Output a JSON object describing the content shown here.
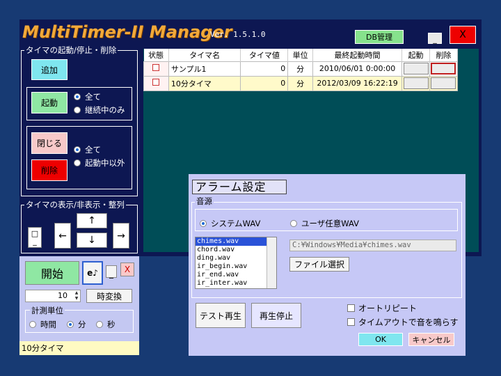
{
  "manager": {
    "title": "MultiTimer-II Manager",
    "version": "Ver. 1.5.1.0",
    "db_button": "DB管理",
    "minimize": "_",
    "close": "X",
    "control_group": {
      "legend": "タイマの起動/停止・削除",
      "add": "追加",
      "start": "起動",
      "start_opts": [
        "全て",
        "継続中のみ"
      ],
      "close": "閉じる",
      "delete": "削除",
      "close_opts": [
        "全て",
        "起動中以外"
      ]
    },
    "display_group": {
      "legend": "タイマの表示/非表示・整列",
      "box_icon": "□",
      "up": "↑",
      "down": "↓",
      "left": "←",
      "right": "→"
    },
    "table": {
      "headers": [
        "状態",
        "タイマ名",
        "タイマ値",
        "単位",
        "最終起動時間",
        "起動",
        "削除"
      ],
      "rows": [
        {
          "name": "サンプル1",
          "value": "0",
          "unit": "分",
          "last": "2010/06/01 0:00:00"
        },
        {
          "name": "10分タイマ",
          "value": "0",
          "unit": "分",
          "last": "2012/03/09 16:22:19"
        }
      ]
    }
  },
  "mini": {
    "start": "開始",
    "sound": "e♪",
    "minimize": "_",
    "close": "X",
    "value": "10",
    "convert": "時変換",
    "unit_legend": "計測単位",
    "units": [
      "時間",
      "分",
      "秒"
    ],
    "status": "10分タイマ"
  },
  "alarm": {
    "title": "アラーム設定",
    "source_legend": "音源",
    "sources": [
      "システムWAV",
      "ユーザ任意WAV"
    ],
    "files": [
      "chimes.wav",
      "chord.wav",
      "ding.wav",
      "ir_begin.wav",
      "ir_end.wav",
      "ir_inter.wav"
    ],
    "path": "C:¥Windows¥Media¥chimes.wav",
    "choose_file": "ファイル選択",
    "test_play": "テスト再生",
    "stop_play": "再生停止",
    "auto_repeat": "オートリピート",
    "timeout_sound": "タイムアウトで音を鳴らす",
    "ok": "OK",
    "cancel": "キャンセル"
  }
}
